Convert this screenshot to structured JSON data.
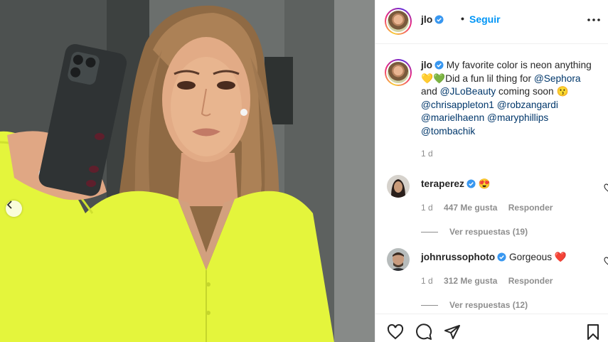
{
  "post": {
    "username": "jlo",
    "follow_label": "Seguir",
    "separator": "•",
    "colors": {
      "accent": "#0095f6",
      "mention": "#00376b",
      "muted": "#8e8e8e",
      "heart": "#ed4956",
      "dress": "#e4f53c"
    }
  },
  "caption": {
    "username": "jlo",
    "line1": "My favorite color is neon anything",
    "hearts": "💛💚",
    "line2": "Did a fun lil thing for",
    "mention_sephora": "@Sephora",
    "and": "and",
    "mention_beauty": "@JLoBeauty",
    "coming": "coming soon",
    "emoji": "😗",
    "mentions": [
      "@chrisappleton1",
      "@robzangardi",
      "@marielhaenn",
      "@maryphillips",
      "@tombachik"
    ],
    "age": "1 d"
  },
  "comments": [
    {
      "username": "teraperez",
      "text": "😍",
      "age": "1 d",
      "likes": "447 Me gusta",
      "reply_label": "Responder",
      "view_replies": "Ver respuestas (19)"
    },
    {
      "username": "johnrussophoto",
      "text": "Gorgeous ❤️",
      "age": "1 d",
      "likes": "312 Me gusta",
      "reply_label": "Responder",
      "view_replies": "Ver respuestas (12)"
    }
  ],
  "icons": {
    "like": "heart-icon",
    "comment": "comment-icon",
    "share": "share-icon",
    "save": "bookmark-icon",
    "more": "more-options-icon",
    "verified": "verified-badge-icon",
    "carousel": "chevron-left-icon"
  }
}
